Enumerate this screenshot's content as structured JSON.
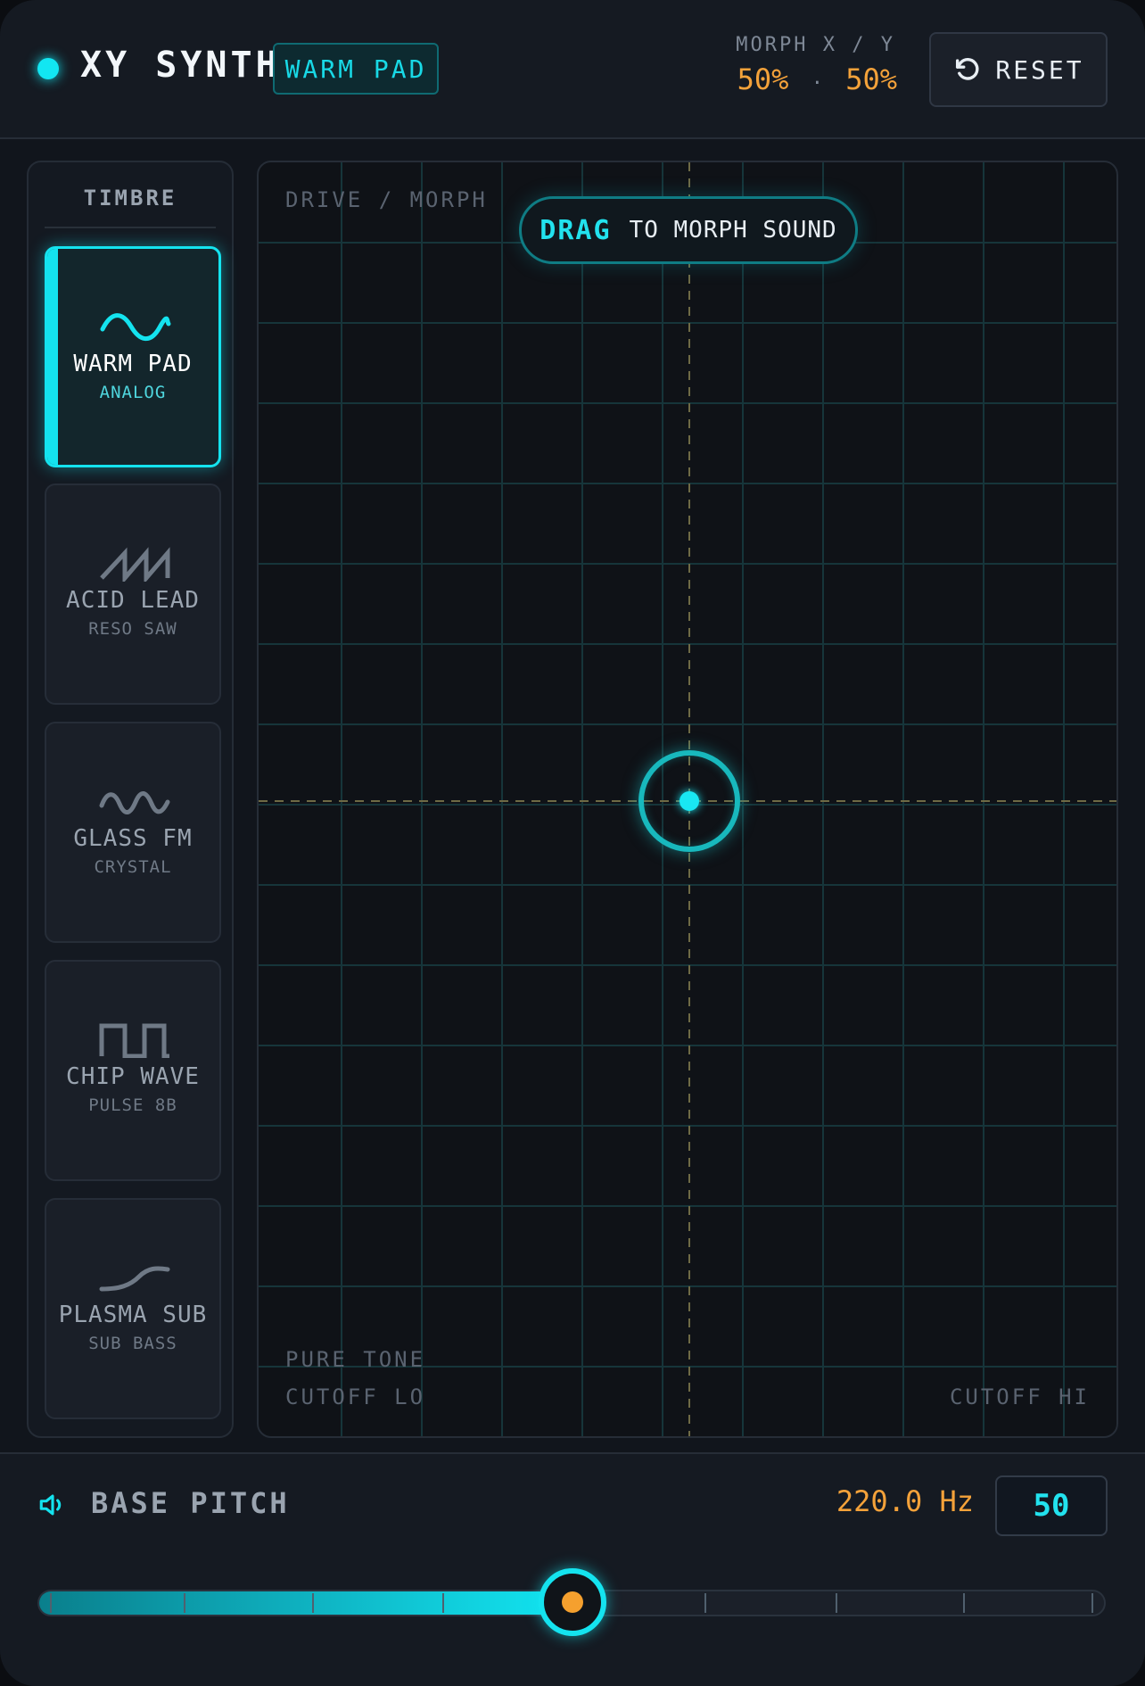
{
  "header": {
    "title": "XY SYNTH",
    "preset": "WARM PAD",
    "morph_label": "MORPH X / Y",
    "morph_x": "50%",
    "morph_y": "50%",
    "morph_separator": "·",
    "reset_label": "RESET"
  },
  "sidebar": {
    "title": "TIMBRE",
    "items": [
      {
        "name": "WARM PAD",
        "sub": "ANALOG",
        "icon": "sine-wave-icon",
        "active": true
      },
      {
        "name": "ACID LEAD",
        "sub": "RESO SAW",
        "icon": "saw-wave-icon",
        "active": false
      },
      {
        "name": "GLASS FM",
        "sub": "CRYSTAL",
        "icon": "fm-wave-icon",
        "active": false
      },
      {
        "name": "CHIP WAVE",
        "sub": "PULSE 8B",
        "icon": "square-wave-icon",
        "active": false
      },
      {
        "name": "PLASMA SUB",
        "sub": "SUB BASS",
        "icon": "sub-wave-icon",
        "active": false
      }
    ]
  },
  "pad": {
    "top_label": "DRIVE / MORPH",
    "hint_strong": "DRAG",
    "hint_rest": "TO MORPH SOUND",
    "bottom_left_1": "PURE TONE",
    "bottom_left_2": "CUTOFF LO",
    "bottom_right": "CUTOFF HI",
    "handle_x": 0.5,
    "handle_y": 0.5
  },
  "pitch": {
    "label": "BASE PITCH",
    "hz": "220.0 Hz",
    "value": "50",
    "fraction": 0.5
  },
  "colors": {
    "accent": "#14e3ef",
    "warm": "#f4a23a",
    "background": "#11151c"
  }
}
